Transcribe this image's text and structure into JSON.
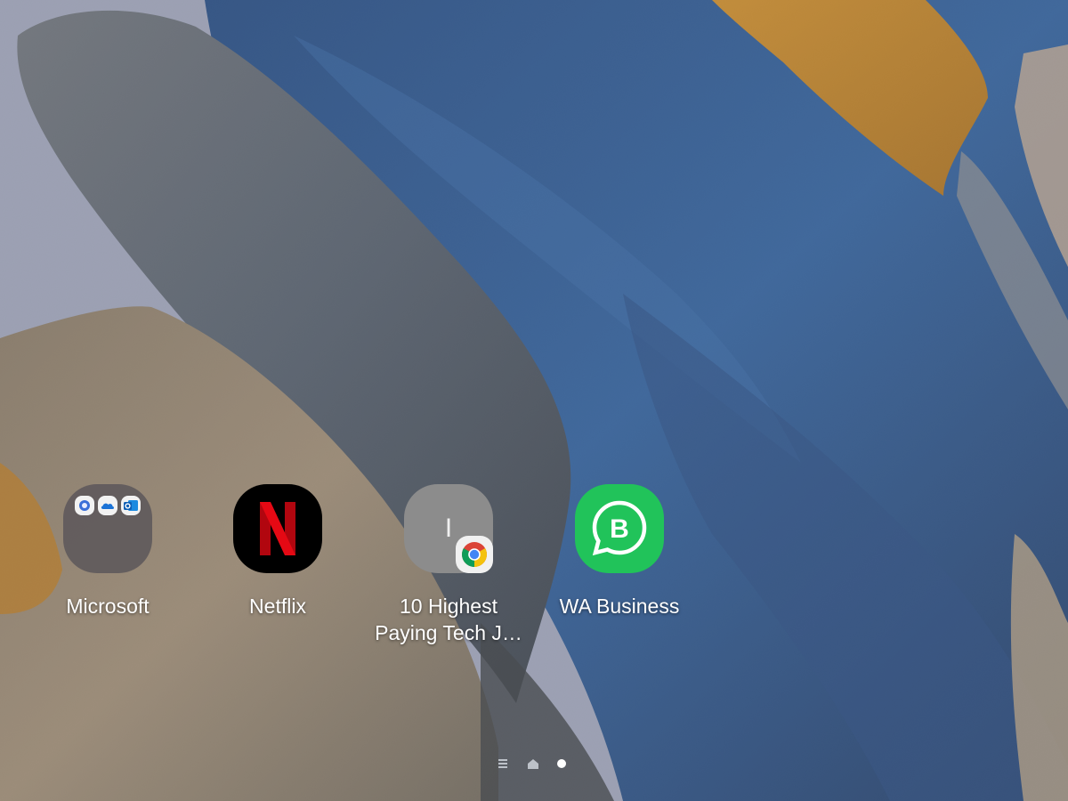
{
  "wallpaper": {
    "colors": {
      "sky": "#a9b0cc",
      "blue": "#1f4f94",
      "deep_blue": "#0d2f66",
      "slate": "#4c5a6e",
      "orange": "#d9880f",
      "tan": "#a38a68"
    }
  },
  "home": {
    "apps": [
      {
        "label": "Microsoft",
        "icon": "folder-icon",
        "contains": [
          "copilot-icon",
          "onedrive-icon",
          "outlook-icon"
        ]
      },
      {
        "label": "Netflix",
        "icon": "netflix-icon",
        "glyph": "N",
        "color": "#e50914"
      },
      {
        "label": "10 Highest\nPaying Tech J…",
        "icon": "shortcut-icon",
        "glyph": "I",
        "badge": "chrome-icon"
      },
      {
        "label": "WA Business",
        "icon": "whatsapp-business-icon",
        "glyph": "B",
        "color": "#21c35a"
      }
    ]
  },
  "page_indicator": {
    "items": [
      "menu-icon",
      "home-icon",
      "page-dot"
    ],
    "active_index": 2
  }
}
